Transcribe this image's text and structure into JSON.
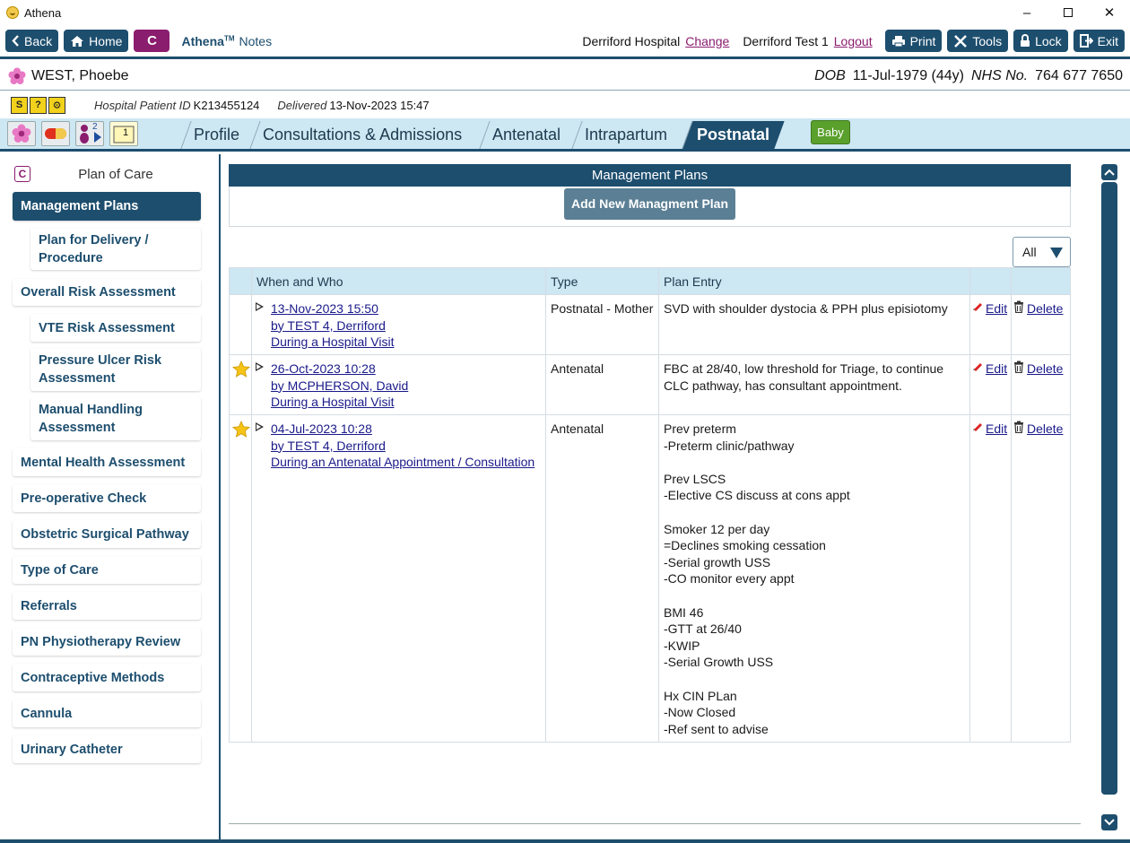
{
  "window": {
    "title": "Athena"
  },
  "toolbar": {
    "back": "Back",
    "home": "Home",
    "c_label": "C",
    "app_name": "Athena",
    "app_tm": "TM",
    "app_suffix": "Notes",
    "hospital": "Derriford Hospital",
    "change": "Change",
    "user": "Derriford Test 1",
    "logout": "Logout",
    "print": "Print",
    "tools": "Tools",
    "lock": "Lock",
    "exit": "Exit"
  },
  "patient": {
    "name": "WEST, Phoebe",
    "dob_label": "DOB",
    "dob": "11-Jul-1979 (44y)",
    "nhs_label": "NHS No.",
    "nhs": "764 677 7650",
    "hosp_id_label": "Hospital Patient ID",
    "hosp_id": "K213455124",
    "delivered_label": "Delivered",
    "delivered": "13-Nov-2023 15:47"
  },
  "status_icons": [
    "S",
    "?",
    "⚙"
  ],
  "tabs": {
    "profile": "Profile",
    "consultations": "Consultations & Admissions",
    "antenatal": "Antenatal",
    "intrapartum": "Intrapartum",
    "postnatal": "Postnatal",
    "baby": "Baby",
    "mini_badge_2": "2",
    "mini_badge_1": "1"
  },
  "sidebar": {
    "title": "Plan of Care",
    "items": [
      {
        "label": "Management Plans"
      },
      {
        "label": "Plan for Delivery / Procedure"
      },
      {
        "label": "Overall Risk Assessment"
      },
      {
        "label": "VTE Risk Assessment"
      },
      {
        "label": "Pressure Ulcer Risk Assessment"
      },
      {
        "label": "Manual Handling Assessment"
      },
      {
        "label": "Mental Health Assessment"
      },
      {
        "label": "Pre-operative Check"
      },
      {
        "label": "Obstetric Surgical Pathway"
      },
      {
        "label": "Type of Care"
      },
      {
        "label": "Referrals"
      },
      {
        "label": "PN Physiotherapy Review"
      },
      {
        "label": "Contraceptive Methods"
      },
      {
        "label": "Cannula"
      },
      {
        "label": "Urinary Catheter"
      }
    ]
  },
  "main": {
    "title": "Management Plans",
    "add_button": "Add New Managment Plan",
    "filter": "All",
    "columns": [
      "When and Who",
      "Type",
      "Plan Entry"
    ],
    "edit": "Edit",
    "delete": "Delete",
    "rows": [
      {
        "starred": false,
        "date": "13-Nov-2023 15:50",
        "by": "by TEST 4, Derriford",
        "context": "During a Hospital Visit",
        "type": "Postnatal - Mother",
        "entry": "SVD with shoulder dystocia & PPH plus episiotomy"
      },
      {
        "starred": true,
        "date": "26-Oct-2023 10:28",
        "by": "by MCPHERSON, David",
        "context": "During a Hospital Visit",
        "type": "Antenatal",
        "entry": "FBC at 28/40, low threshold for Triage, to continue CLC pathway, has consultant appointment."
      },
      {
        "starred": true,
        "date": "04-Jul-2023 10:28",
        "by": "by TEST 4, Derriford",
        "context": "During an Antenatal Appointment / Consultation",
        "type": "Antenatal",
        "entry": "Prev preterm\n-Preterm clinic/pathway\n\nPrev LSCS\n-Elective CS discuss at cons appt\n\nSmoker 12 per day\n=Declines smoking cessation\n-Serial growth USS\n-CO monitor every appt\n\nBMI 46\n-GTT at 26/40\n-KWIP\n-Serial Growth USS\n\nHx CIN PLan\n-Now Closed\n-Ref sent to advise"
      }
    ]
  },
  "colors": {
    "primary": "#1d4e6e",
    "accent": "#8a1d6e",
    "tab_bg": "#cde7f3",
    "baby": "#5aa02c"
  }
}
